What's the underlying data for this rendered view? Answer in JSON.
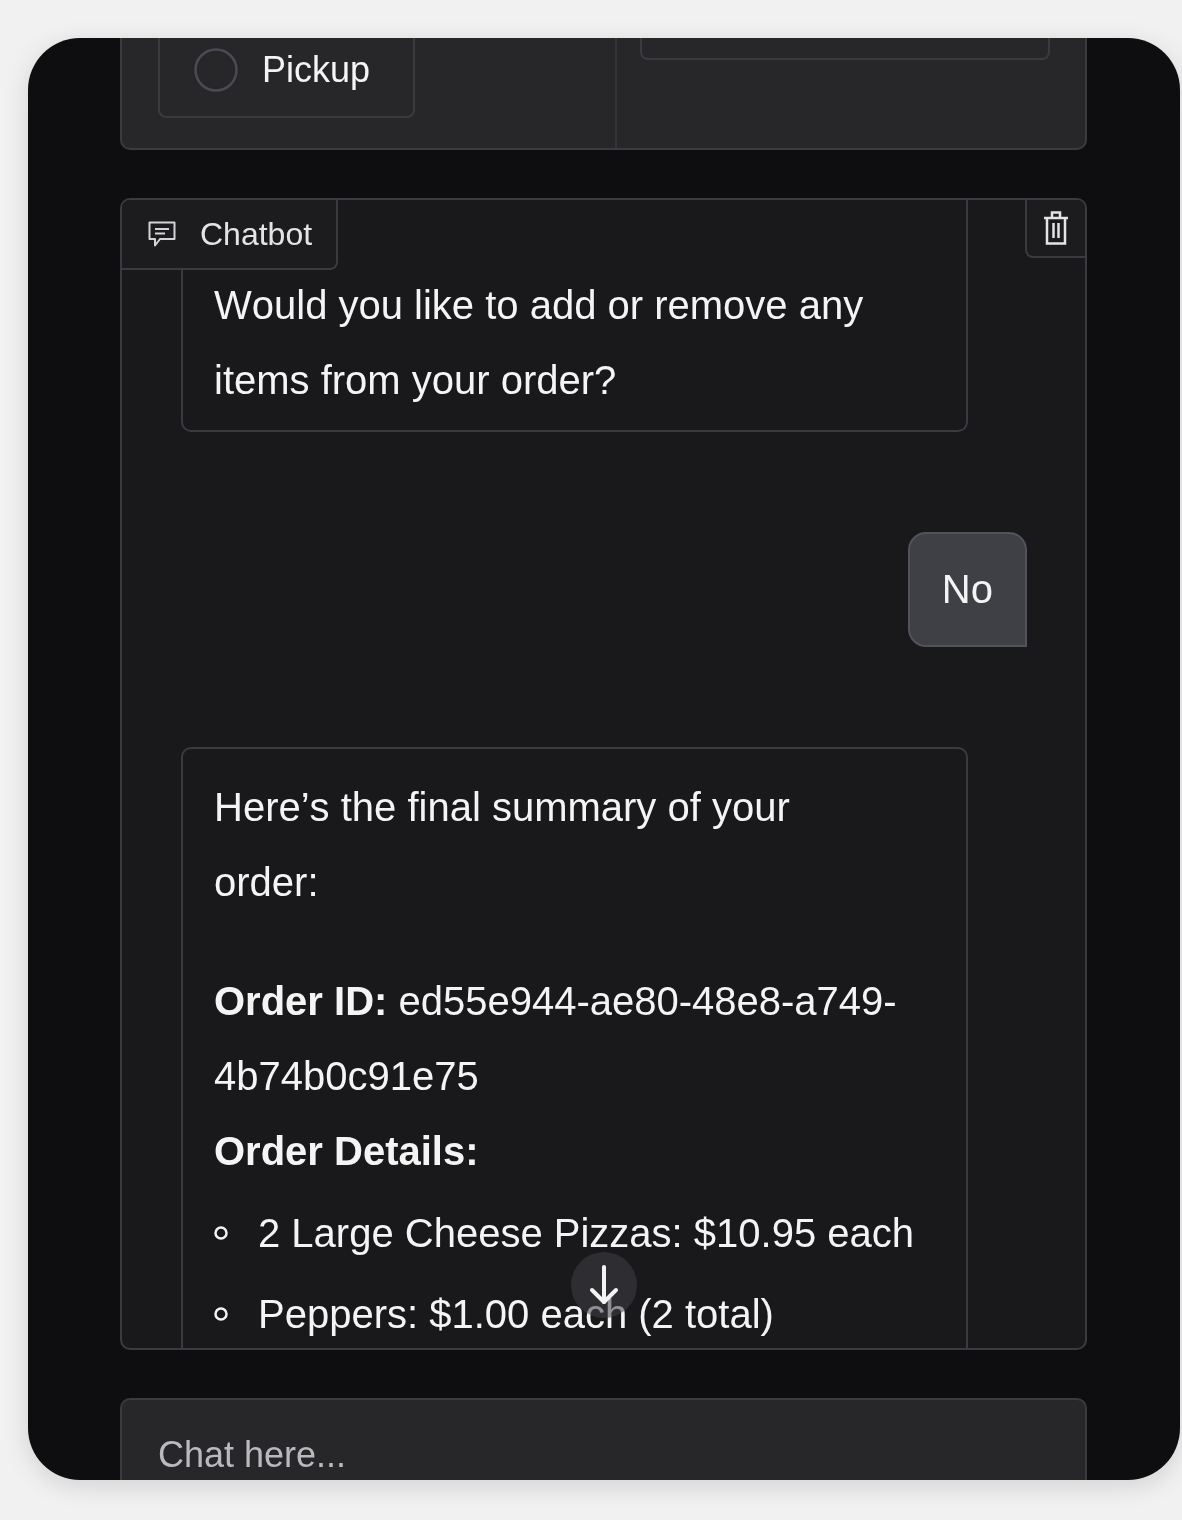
{
  "options_panel": {
    "radio_options": [
      {
        "label": "Pickup",
        "selected": false
      }
    ]
  },
  "chatbot": {
    "label": "Chatbot",
    "messages": [
      {
        "kind": "bot",
        "blocks": [
          {
            "kind": "paragraph",
            "text": "Would you like to add or remove any items from your order?"
          }
        ]
      },
      {
        "kind": "user",
        "text": "No"
      },
      {
        "kind": "bot",
        "blocks": [
          {
            "kind": "paragraph",
            "text": "Here’s the final summary of your order:"
          },
          {
            "kind": "paragraph",
            "text": "**Order ID:** ed55e944-ae80-48e8-a749-4b74b0c91e75"
          },
          {
            "kind": "heading",
            "text": "Order Details:"
          },
          {
            "kind": "list",
            "items": [
              "2 Large Cheese Pizzas: $10.95 each",
              "Peppers: $1.00 each (2 total)"
            ]
          }
        ]
      }
    ]
  },
  "chat_input": {
    "placeholder": "Chat here..."
  }
}
